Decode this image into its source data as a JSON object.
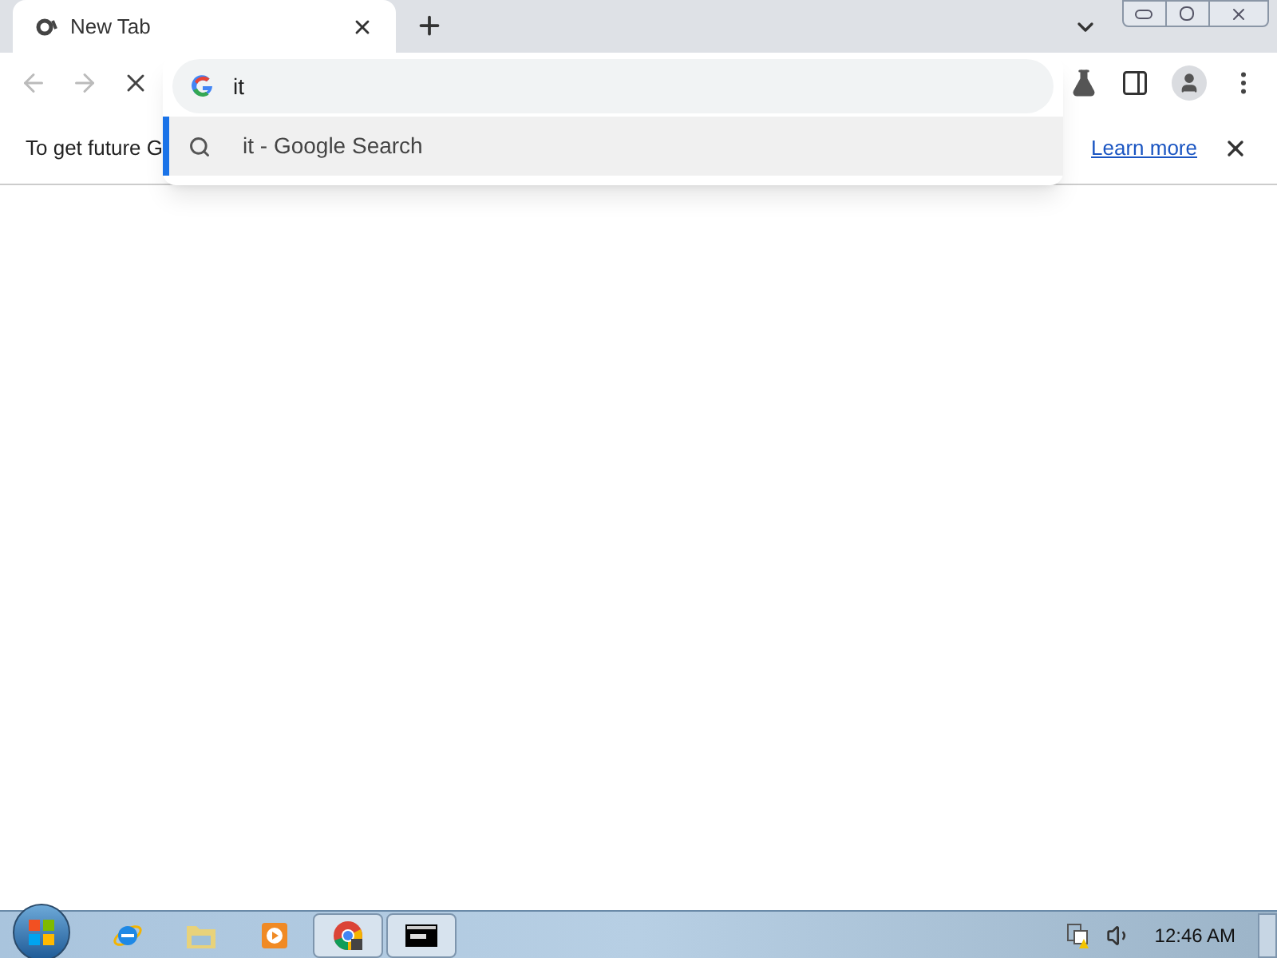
{
  "tab": {
    "title": "New Tab",
    "selected": true
  },
  "omnibox": {
    "value": "it"
  },
  "suggestion": {
    "text": "it - Google Search",
    "selected": true
  },
  "infobar": {
    "message": "To get future G",
    "link": "Learn more"
  },
  "taskbar": {
    "items": [
      {
        "kind": "ie",
        "selected": false
      },
      {
        "kind": "folder",
        "selected": false
      },
      {
        "kind": "media",
        "selected": false
      },
      {
        "kind": "chrome",
        "selected": true
      },
      {
        "kind": "cmd",
        "selected": true
      }
    ],
    "clock": "12:46 AM"
  }
}
